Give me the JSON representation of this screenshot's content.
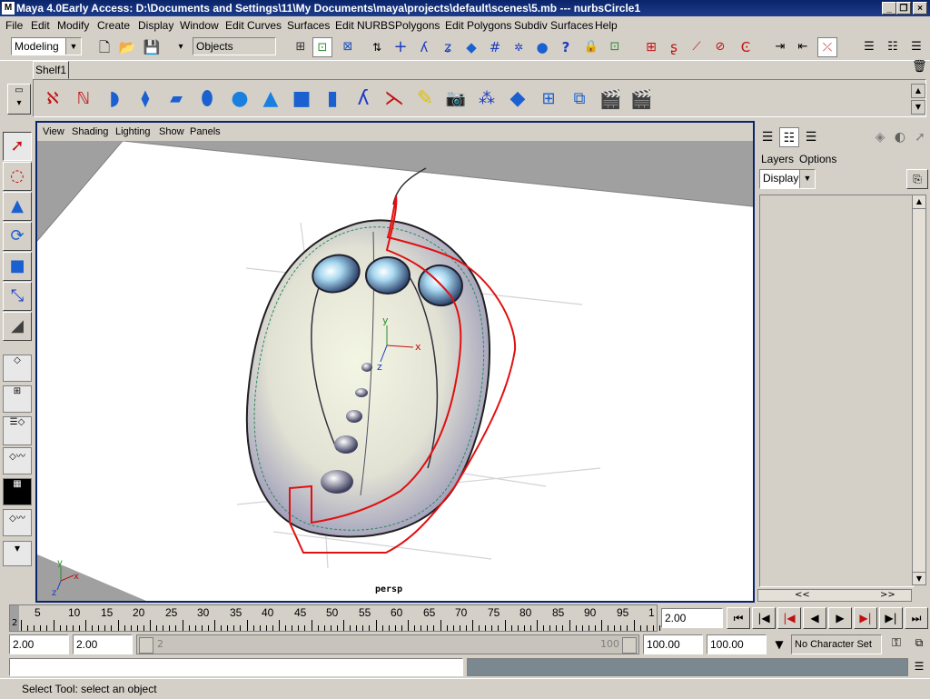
{
  "window": {
    "title": "Maya 4.0Early Access: D:\\Documents and Settings\\11\\My Documents\\maya\\projects\\default\\scenes\\5.mb  ---  nurbsCircle1",
    "minimize": "_",
    "restore": "❐",
    "close": "×"
  },
  "menubar": [
    "File",
    "Edit",
    "Modify",
    "Create",
    "Display",
    "Window",
    "Edit Curves",
    "Surfaces",
    "Edit NURBS",
    "Polygons",
    "Edit Polygons",
    "Subdiv Surfaces",
    "Help"
  ],
  "statusline": {
    "mode": "Modeling",
    "selection_field": "Objects"
  },
  "shelf": {
    "tab": "Shelf1",
    "icons": [
      "cv-curve-icon",
      "ep-curve-icon",
      "revolve-icon",
      "loft-icon",
      "planar-icon",
      "extrude-icon",
      "sphere-icon",
      "cone-icon",
      "cube-icon",
      "cylinder-icon",
      "joint-icon",
      "ik-handle-icon",
      "spot-light-icon",
      "camera-icon",
      "particles-icon",
      "lattice-icon",
      "cluster-icon",
      "wrap-icon",
      "render-icon",
      "ipr-render-icon"
    ]
  },
  "viewport": {
    "menu": [
      "View",
      "Shading",
      "Lighting",
      "Show",
      "Panels"
    ],
    "camera": "persp",
    "axis_labels": {
      "x": "x",
      "y": "y",
      "z": "z"
    }
  },
  "rightpanel": {
    "menu": [
      "Layers",
      "Options"
    ],
    "display_option": "Display",
    "scroll_left": "<<",
    "scroll_right": ">>"
  },
  "timeslider": {
    "ticks": [
      "5",
      "10",
      "15",
      "20",
      "25",
      "30",
      "35",
      "40",
      "45",
      "50",
      "55",
      "60",
      "65",
      "70",
      "75",
      "80",
      "85",
      "90",
      "95",
      "1"
    ],
    "current_frame_marker": "2",
    "current_time": "2.00"
  },
  "range": {
    "start": "2.00",
    "playback_start": "2.00",
    "slider_min": "2",
    "slider_max": "100",
    "playback_end": "100.00",
    "end": "100.00",
    "character_set": "No Character Set"
  },
  "helpline": "Select Tool: select an object",
  "colors": {
    "chrome": "#d4d0c8",
    "title_bar": "#0a246a",
    "active_panel_border": "#0a246a",
    "selection_curve": "#e01010"
  }
}
